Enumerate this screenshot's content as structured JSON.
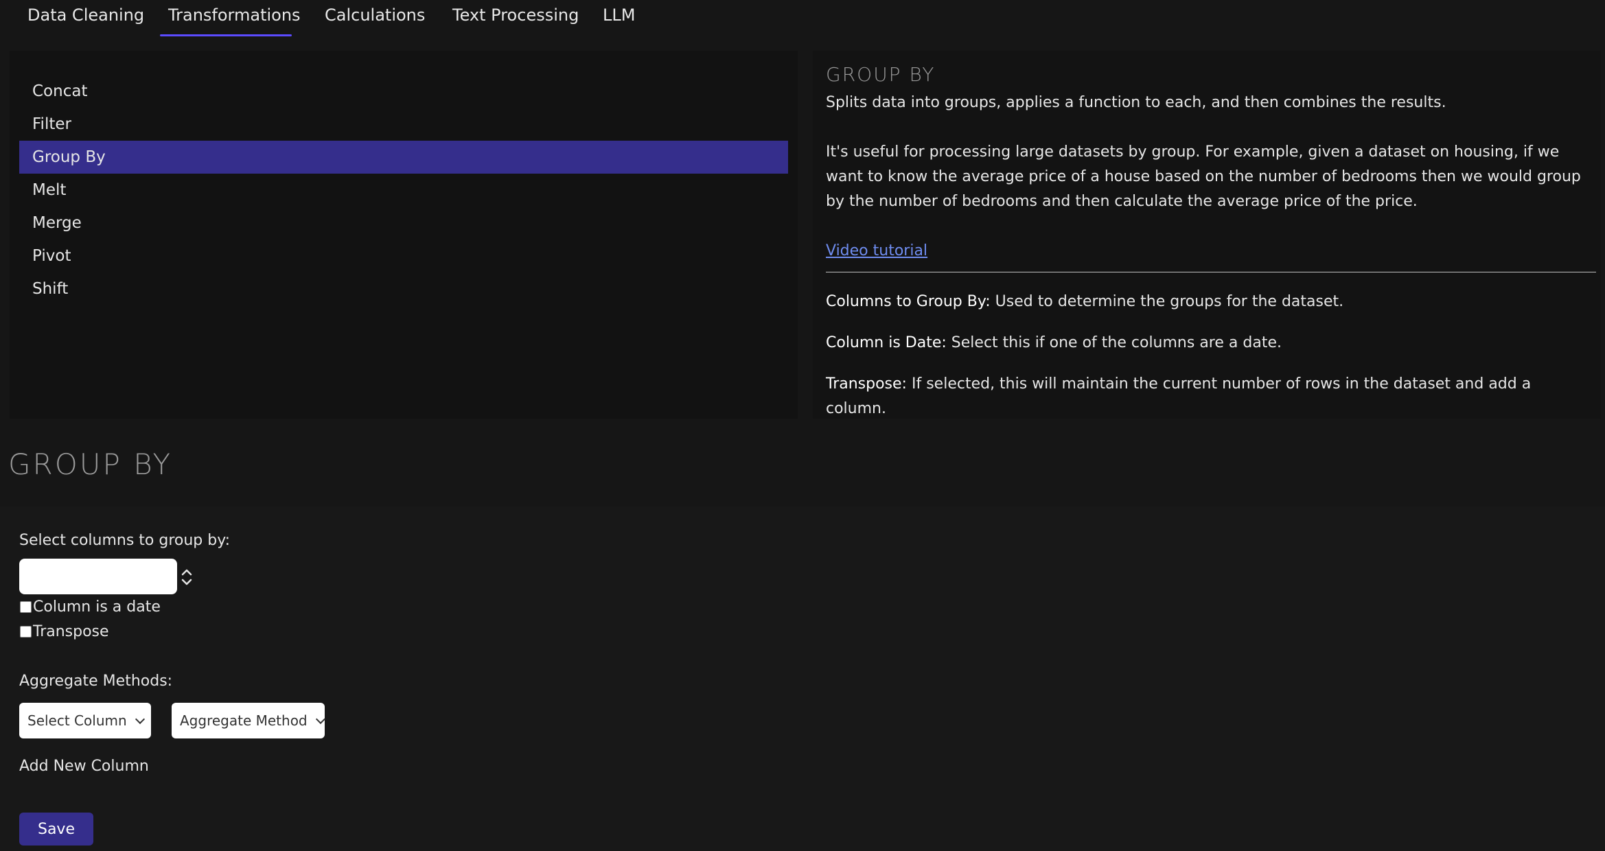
{
  "tabs": [
    {
      "label": "Data Cleaning"
    },
    {
      "label": "Transformations"
    },
    {
      "label": "Calculations"
    },
    {
      "label": "Text Processing"
    },
    {
      "label": "LLM"
    }
  ],
  "sidebar": {
    "items": [
      {
        "label": "Concat"
      },
      {
        "label": "Filter"
      },
      {
        "label": "Group By"
      },
      {
        "label": "Melt"
      },
      {
        "label": "Merge"
      },
      {
        "label": "Pivot"
      },
      {
        "label": "Shift"
      }
    ]
  },
  "info": {
    "title": "GROUP BY",
    "summary": "Splits data into groups, applies a function to each, and then combines the results.",
    "detail": "It's useful for processing large datasets by group. For example, given a dataset on housing, if we want to know the average price of a house based on the number of bedrooms then we would group by the number of bedrooms and then calculate the average price of the price.",
    "link_text": "Video tutorial",
    "params": [
      {
        "name": "Columns to Group By:",
        "desc": " Used to determine the groups for the dataset."
      },
      {
        "name": "Column is Date:",
        "desc": " Select this if one of the columns are a date."
      },
      {
        "name": "Transpose:",
        "desc": " If selected, this will maintain the current number of rows in the dataset and add a column."
      }
    ]
  },
  "form": {
    "title": "GROUP BY",
    "group_label": "Select columns to group by:",
    "date_checkbox_label": "Column is a date",
    "transpose_checkbox_label": "Transpose",
    "aggregate_label": "Aggregate Methods:",
    "select_column": "Select Column",
    "aggregate_method": "Aggregate Method",
    "add_new_column": "Add New Column",
    "save": "Save"
  }
}
